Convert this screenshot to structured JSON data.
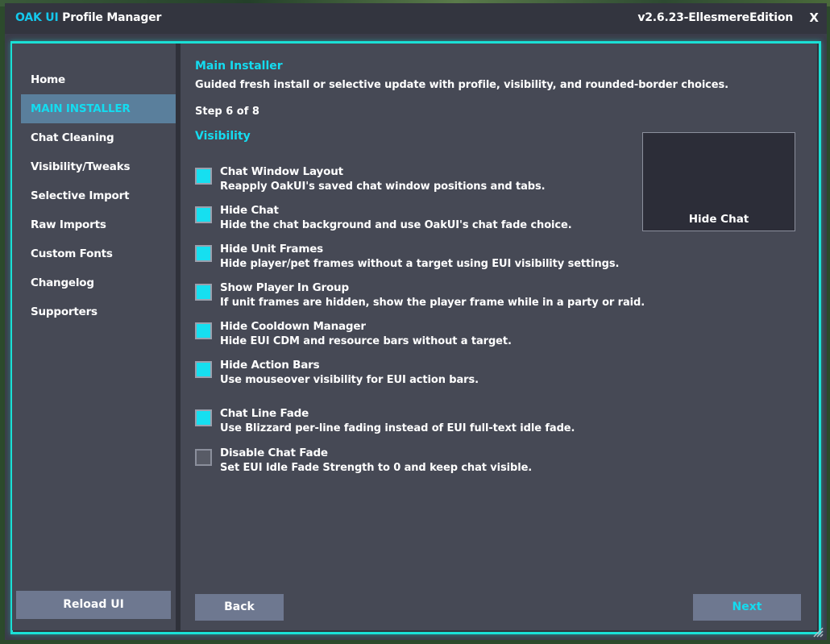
{
  "window": {
    "title_accent": "OAK UI",
    "title_rest": " Profile Manager",
    "version": "v2.6.23-EllesmereEdition",
    "close_label": "X"
  },
  "sidebar": {
    "items": [
      {
        "label": "Home",
        "active": false
      },
      {
        "label": "MAIN INSTALLER",
        "active": true
      },
      {
        "label": "Chat Cleaning",
        "active": false
      },
      {
        "label": "Visibility/Tweaks",
        "active": false
      },
      {
        "label": "Selective Import",
        "active": false
      },
      {
        "label": "Raw Imports",
        "active": false
      },
      {
        "label": "Custom Fonts",
        "active": false
      },
      {
        "label": "Changelog",
        "active": false
      },
      {
        "label": "Supporters",
        "active": false
      }
    ],
    "reload_label": "Reload UI"
  },
  "main": {
    "title": "Main Installer",
    "description": "Guided fresh install or selective update with profile, visibility, and rounded-border choices.",
    "step": "Step 6 of 8",
    "section": "Visibility",
    "options": [
      {
        "label": "Chat Window Layout",
        "desc": "Reapply OakUI's saved chat window positions and tabs.",
        "checked": true
      },
      {
        "label": "Hide Chat",
        "desc": "Hide the chat background and use OakUI's chat fade choice.",
        "checked": true
      },
      {
        "label": "Hide Unit Frames",
        "desc": "Hide player/pet frames without a target using EUI visibility settings.",
        "checked": true
      },
      {
        "label": "Show Player In Group",
        "desc": "If unit frames are hidden, show the player frame while in a party or raid.",
        "checked": true
      },
      {
        "label": "Hide Cooldown Manager",
        "desc": "Hide EUI CDM and resource bars without a target.",
        "checked": true
      },
      {
        "label": "Hide Action Bars",
        "desc": "Use mouseover visibility for EUI action bars.",
        "checked": true
      },
      {
        "label": "Chat Line Fade",
        "desc": "Use Blizzard per-line fading instead of EUI full-text idle fade.",
        "checked": true
      },
      {
        "label": "Disable Chat Fade",
        "desc": "Set EUI Idle Fade Strength to 0 and keep chat visible.",
        "checked": false
      }
    ],
    "preview_label": "Hide Chat",
    "back_label": "Back",
    "next_label": "Next"
  },
  "colors": {
    "accent": "#14dcf0",
    "frame_border": "#1ae0d6",
    "panel": "#464955",
    "button": "#6e7890",
    "active_nav": "#5a7f9c"
  },
  "icons": {
    "close": "close-icon",
    "resize": "resize-grip-icon",
    "checkbox": "checkbox-icon"
  }
}
